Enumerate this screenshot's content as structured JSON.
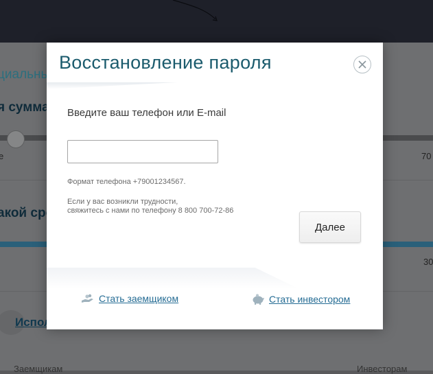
{
  "background": {
    "text_1": "циальны",
    "text_2": "я сумма",
    "slider_min_label": "е",
    "slider_max_label": "70",
    "text_3": "акой сро",
    "slider2_max_label": "30",
    "link": "Исполь",
    "bottom_left": "Заемщикам",
    "bottom_right": "Инвесторам"
  },
  "modal": {
    "title": "Восстановление пароля",
    "prompt": "Введите ваш телефон или E-mail",
    "input": {
      "value": "",
      "placeholder": ""
    },
    "format_hint": "Формат телефона +79001234567.",
    "help_line_1": "Если у вас возникли трудности,",
    "help_line_2": "свяжитесь с нами по телефону 8 800 700-72-86",
    "next_button": "Далее",
    "close_icon": "close-circle-icon",
    "footer": {
      "borrower_link": "Стать заемщиком",
      "borrower_icon": "hand-coins-icon",
      "investor_link": "Стать инвестором",
      "investor_icon": "piggy-bank-icon"
    }
  },
  "colors": {
    "title": "#1b5b6d",
    "link": "#256c94",
    "overlay_header": "#1e2029"
  }
}
